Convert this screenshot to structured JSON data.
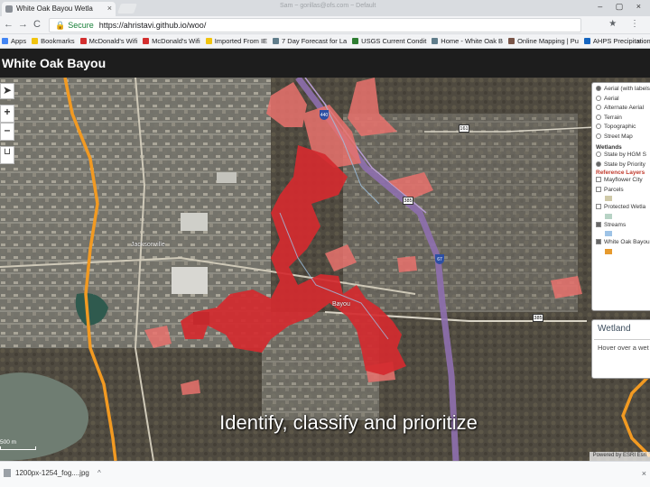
{
  "browser": {
    "tab_title": "White Oak Bayou Wetla",
    "tab_close": "×",
    "window_title": "Sam ~ gorillas@ofs.com ~ Default",
    "window_controls": "–  ▢  ×",
    "nav": {
      "back": "←",
      "forward": "→",
      "reload": "C"
    },
    "secure_icon": "🔒",
    "secure_label": "Secure",
    "url": "https://ahristavi.github.io/woo/",
    "ext_icons": "★ ⋮",
    "bookmarks": [
      {
        "label": "Apps",
        "color": "#4285f4"
      },
      {
        "label": "Bookmarks",
        "color": "#f1c40f"
      },
      {
        "label": "McDonald's Wifi",
        "color": "#d32f2f"
      },
      {
        "label": "McDonald's Wifi",
        "color": "#d32f2f"
      },
      {
        "label": "Imported From IE",
        "color": "#f1c40f"
      },
      {
        "label": "7 Day Forecast for La",
        "color": "#607d8b"
      },
      {
        "label": "USGS Current Condit",
        "color": "#2e7d32"
      },
      {
        "label": "Home - White Oak B",
        "color": "#607d8b"
      },
      {
        "label": "Online Mapping | Pu",
        "color": "#795548"
      },
      {
        "label": "AHPS Precipitation A",
        "color": "#1565c0"
      }
    ],
    "bookmarks_more": "»"
  },
  "app": {
    "title": "White Oak Bayou"
  },
  "map": {
    "controls": {
      "locate": "➤",
      "zoom_in": "+",
      "zoom_out": "–",
      "extent": "⊔"
    },
    "caption": "Identify, classify and prioritize",
    "scale_label": "500 m",
    "attribution": "Powered by ESRI  Esri",
    "labels": {
      "jacksonville": "Jacksonville",
      "bayou": "Bayou"
    },
    "shields": {
      "s1": "161",
      "s2": "385",
      "i1": "440",
      "i2": "67",
      "s3": "385"
    }
  },
  "layers_panel": {
    "basemaps": [
      {
        "label": "Aerial (with labels)",
        "selected": true
      },
      {
        "label": "Aerial",
        "selected": false
      },
      {
        "label": "Alternate Aerial",
        "selected": false
      },
      {
        "label": "Terrain",
        "selected": false
      },
      {
        "label": "Topographic",
        "selected": false
      },
      {
        "label": "Street Map",
        "selected": false
      }
    ],
    "wetlands_heading": "Wetlands",
    "wetlands_options": [
      {
        "label": "State by HGM S",
        "selected": false
      },
      {
        "label": "State by Priority",
        "selected": true
      }
    ],
    "reference_heading": "Reference Layers",
    "reference": [
      {
        "label": "Mayflower City",
        "checked": false,
        "swatch": ""
      },
      {
        "label": "Parcels",
        "checked": false,
        "swatch": "#cfc9a8"
      },
      {
        "label": "Protected Wetla",
        "checked": false,
        "swatch": "#b7d3c5"
      },
      {
        "label": "Streams",
        "checked": true,
        "swatch": "#9ec3e6"
      },
      {
        "label": "White Oak Bayou",
        "checked": true,
        "swatch": "#e69a2e"
      }
    ]
  },
  "wetland_panel": {
    "title": "Wetland",
    "hint": "Hover over a wet"
  },
  "download_bar": {
    "filename": "1200px-1254_fog....jpg",
    "arrow": "^",
    "close": "×"
  },
  "colors": {
    "high_priority": "#d42a2f",
    "medium_priority": "#e9726d",
    "watershed_boundary": "#f29a22",
    "highway": "#8e6fae"
  }
}
